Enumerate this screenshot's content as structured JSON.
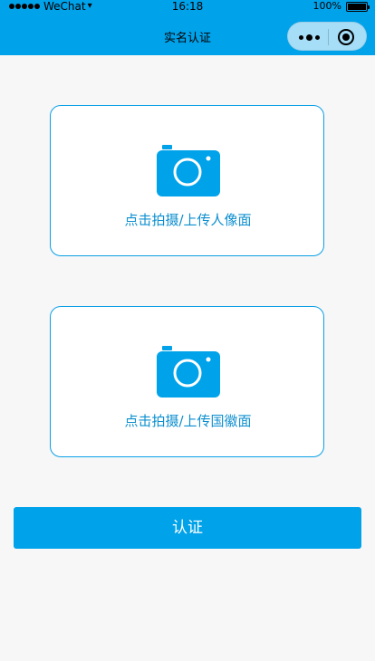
{
  "status_bar": {
    "carrier": "WeChat",
    "time": "16:18",
    "battery": "100%"
  },
  "nav": {
    "title": "实名认证",
    "capsule_more_icon": "more-dots-icon",
    "capsule_close_icon": "target-close-icon"
  },
  "cards": [
    {
      "icon": "camera-icon",
      "label": "点击拍摄/上传人像面"
    },
    {
      "icon": "camera-icon",
      "label": "点击拍摄/上传国徽面"
    }
  ],
  "submit": {
    "label": "认证"
  },
  "colors": {
    "accent": "#00a2ea",
    "card_border": "#0aa0e6",
    "card_text": "#0d8fcf",
    "background": "#f7f7f7"
  }
}
